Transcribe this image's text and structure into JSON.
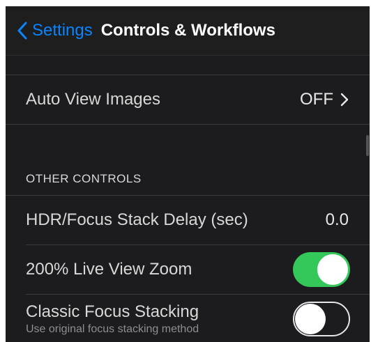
{
  "navbar": {
    "back_label": "Settings",
    "title": "Controls & Workflows"
  },
  "rows": {
    "auto_view": {
      "label": "Auto View Images",
      "value": "OFF"
    },
    "hdr_delay": {
      "label": "HDR/Focus Stack Delay (sec)",
      "value": "0.0"
    },
    "live_zoom": {
      "label": "200% Live View Zoom",
      "toggle": "on"
    },
    "classic_focus": {
      "label": "Classic Focus Stacking",
      "subtitle": "Use original focus stacking method",
      "toggle": "off"
    }
  },
  "sections": {
    "other_controls": "OTHER CONTROLS"
  },
  "colors": {
    "accent": "#0a84ff",
    "toggle_on": "#34c759",
    "background": "#1c1c1e"
  },
  "icons": {
    "back": "chevron-left-icon",
    "disclosure": "chevron-right-icon"
  }
}
